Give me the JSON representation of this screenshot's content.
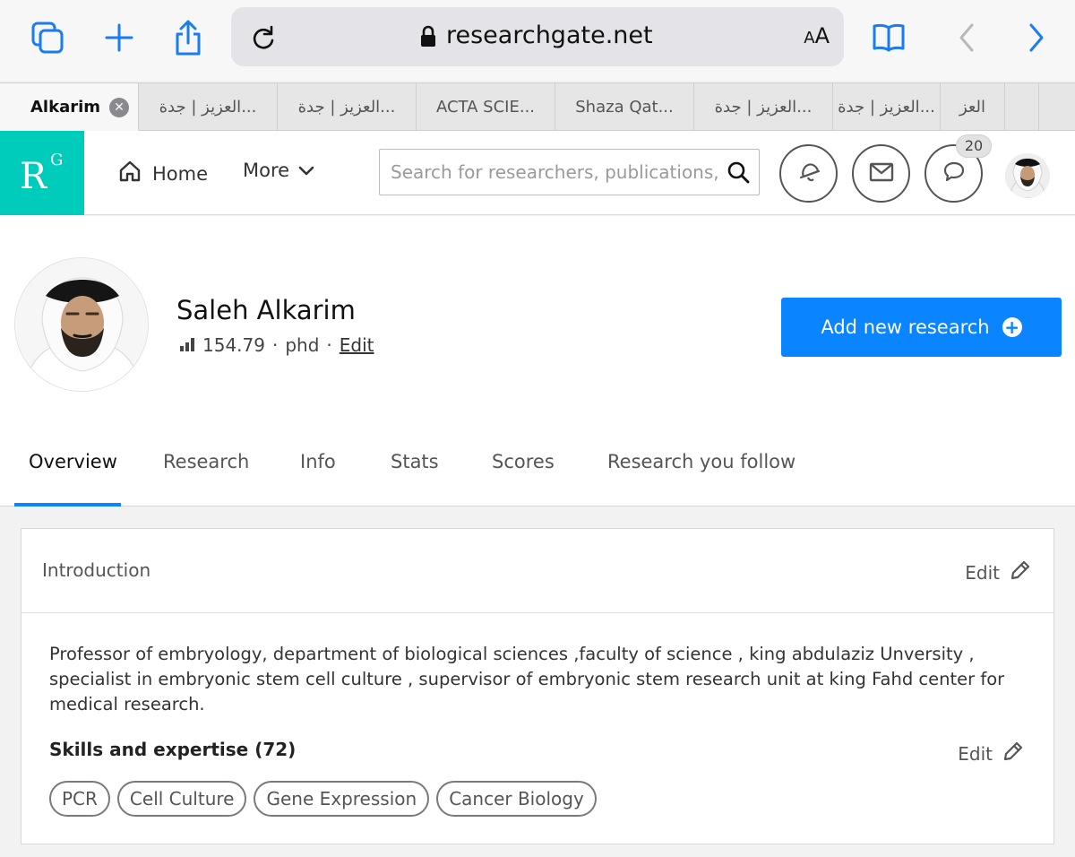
{
  "browser": {
    "url": "researchgate.net",
    "reader_label_large": "A",
    "reader_label_small": "A",
    "icons": [
      "tabs-icon",
      "new-tab-icon",
      "share-icon",
      "reload-icon",
      "lock-icon",
      "bookmarks-icon",
      "back-icon",
      "forward-icon"
    ]
  },
  "tabs": [
    {
      "label": "Alkarim",
      "active": true
    },
    {
      "label": "العزيز | جدة..."
    },
    {
      "label": "العزيز | جدة..."
    },
    {
      "label": "ACTA SCIE..."
    },
    {
      "label": "Shaza Qat..."
    },
    {
      "label": "العزيز | جدة..."
    },
    {
      "label": "العزيز | جدة..."
    },
    {
      "label": "العز"
    }
  ],
  "header": {
    "logo_r": "R",
    "logo_g": "G",
    "nav_home": "Home",
    "nav_more": "More",
    "search_placeholder": "Search for researchers, publications, and more",
    "messages_badge": "20"
  },
  "profile": {
    "name": "Saleh Alkarim",
    "score": "154.79",
    "separator": "·",
    "degree": "phd",
    "edit_label": "Edit",
    "add_research_label": "Add new research",
    "tabs": [
      "Overview",
      "Research",
      "Info",
      "Stats",
      "Scores",
      "Research you follow"
    ]
  },
  "intro": {
    "title": "Introduction",
    "edit_label": "Edit",
    "text": "Professor of embryology, department of biological sciences ,faculty of science , king abdulaziz Unversity , specialist in embryonic stem cell culture , supervisor of embryonic stem research unit at king Fahd center for medical research.",
    "skills_title": "Skills and expertise (72)",
    "skills_edit_label": "Edit",
    "skills": [
      "PCR",
      "Cell Culture",
      "Gene Expression",
      "Cancer Biology"
    ]
  },
  "colors": {
    "rg_teal": "#00ccbb",
    "accent_blue": "#0a84ff",
    "safari_blue": "#1a7cf2"
  }
}
